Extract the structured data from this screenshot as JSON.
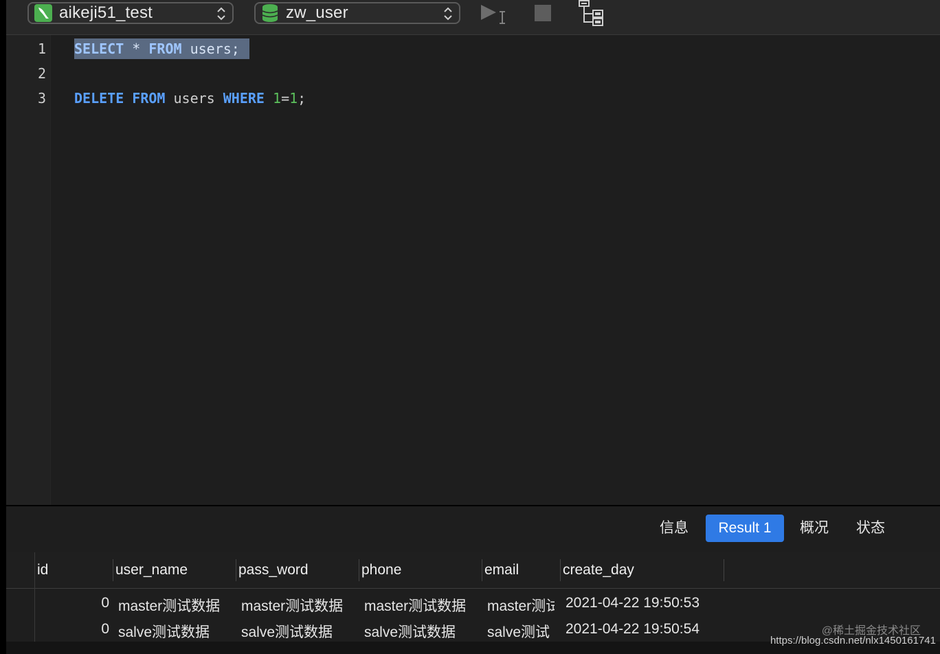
{
  "toolbar": {
    "connection": {
      "label": "aikeji51_test",
      "icon": "mysql-connection-icon",
      "icon_color": "#4caf50"
    },
    "database": {
      "label": "zw_user",
      "icon": "database-icon",
      "icon_color": "#4caf50"
    },
    "run_icon": "run-selection-icon",
    "stop_icon": "stop-icon",
    "explain_icon": "explain-tree-icon"
  },
  "editor": {
    "line_numbers": [
      "1",
      "2",
      "3"
    ],
    "lines": [
      {
        "tokens": [
          {
            "t": "SELECT",
            "k": "kw"
          },
          {
            "t": " * ",
            "k": "op"
          },
          {
            "t": "FROM",
            "k": "kw"
          },
          {
            "t": " users;",
            "k": "ident"
          }
        ],
        "selected": true
      },
      {
        "tokens": [],
        "selected": false
      },
      {
        "tokens": [
          {
            "t": "DELETE",
            "k": "kw"
          },
          {
            "t": " ",
            "k": "ident"
          },
          {
            "t": "FROM",
            "k": "kw"
          },
          {
            "t": " users ",
            "k": "ident"
          },
          {
            "t": "WHERE",
            "k": "kw"
          },
          {
            "t": " ",
            "k": "ident"
          },
          {
            "t": "1",
            "k": "num"
          },
          {
            "t": "=",
            "k": "ident"
          },
          {
            "t": "1",
            "k": "num"
          },
          {
            "t": ";",
            "k": "ident"
          }
        ],
        "selected": false
      }
    ],
    "colors": {
      "keyword": "#5aa0ff",
      "number": "#5cc15c",
      "selection": "#5a6a82"
    }
  },
  "tabs": [
    {
      "label": "信息",
      "active": false
    },
    {
      "label": "Result 1",
      "active": true
    },
    {
      "label": "概况",
      "active": false
    },
    {
      "label": "状态",
      "active": false
    }
  ],
  "result": {
    "columns": [
      "id",
      "user_name",
      "pass_word",
      "phone",
      "email",
      "create_day"
    ],
    "rows": [
      [
        "0",
        "master测试数据",
        "master测试数据",
        "master测试数据",
        "master测试",
        "2021-04-22 19:50:53"
      ],
      [
        "0",
        "salve测试数据",
        "salve测试数据",
        "salve测试数据",
        "salve测试",
        "2021-04-22 19:50:54"
      ]
    ]
  },
  "watermark": {
    "line1": "@稀土掘金技术社区",
    "line2": "https://blog.csdn.net/nlx1450161741"
  }
}
